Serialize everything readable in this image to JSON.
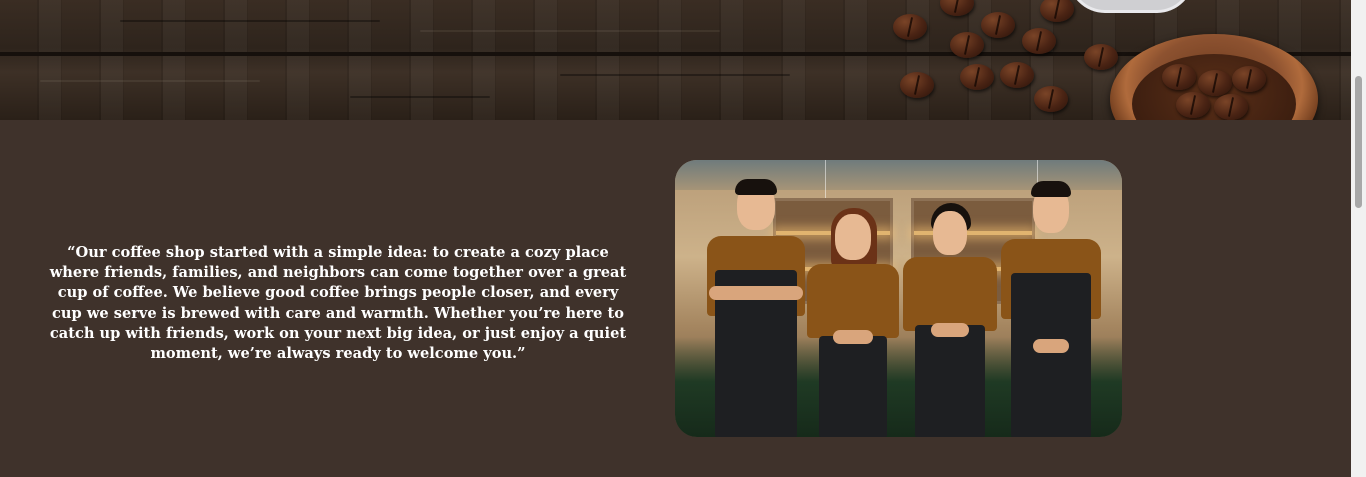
{
  "about": {
    "quote": "“Our coffee shop started with a simple idea: to create a cozy place where friends, families, and neighbors can come together over a great cup of coffee. We believe good coffee brings people closer, and every cup we serve is brewed with care and warmth. Whether you’re here to catch up with friends, work on your next big idea, or just enjoy a quiet moment, we’re always ready to welcome you.”"
  },
  "colors": {
    "section_background": "#3f322b",
    "quote_text": "#ffffff",
    "uniform_shirt": "#8a5418",
    "apron": "#1e1f22"
  },
  "images": {
    "banner": "wooden-table-with-coffee-beans",
    "team_photo": "four-baristas-in-brown-shirts-and-black-aprons"
  }
}
